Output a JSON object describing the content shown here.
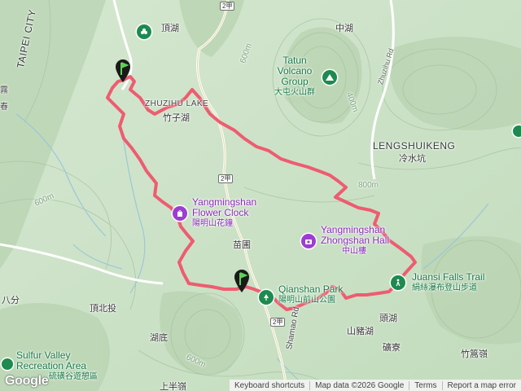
{
  "map": {
    "route_color": "#ee5c70",
    "labels": {
      "dinghu": "頂湖",
      "zhonghu": "中湖",
      "taipei_city": "TAIPEI CITY",
      "tatun_group_en": "Tatun Volcano Group",
      "tatun_group_zh": "大屯火山群",
      "zhuzihu_en": "ZHUZIHU LAKE",
      "zhuzihu_zh": "竹子湖",
      "zhuzihu_rd": "Zhuzihu Rd",
      "lengshuikeng_en": "LENGSHUIKENG",
      "lengshuikeng_zh": "冷水坑",
      "flower_clock_en": "Yangmingshan Flower Clock",
      "flower_clock_zh": "陽明山花鐘",
      "miaopu": "苗圃",
      "zhongshan_hall_en": "Yangmingshan Zhongshan Hall",
      "zhongshan_hall_zh": "中山樓",
      "qianshan_park_en": "Qianshan Park",
      "qianshan_park_zh": "陽明山前山公園",
      "juansi_en": "Juansi Falls Trail",
      "juansi_zh": "絹絲瀑布登山步道",
      "dingbeitou": "頂北投",
      "bafen": "八分",
      "hudi": "湖底",
      "toutian": "頭湖",
      "shanzhuhu": "山豬湖",
      "kuangliao": "礦寮",
      "zhuzailing": "竹篙嶺",
      "sulfur_valley_en": "Sulfur Valley Recreation Area",
      "sulfur_valley_zh": "硫磺谷遊憩區",
      "shangbanling": "上半嶺",
      "shamao_rd": "Shamao Rd",
      "left_edge_1": "霧",
      "left_edge_2": "春"
    },
    "contours": [
      "600m",
      "400m",
      "800m",
      "600m",
      "600m"
    ],
    "road_shields": [
      "2甲",
      "2甲",
      "2甲"
    ],
    "attribution": {
      "shortcuts": "Keyboard shortcuts",
      "data": "Map data ©2026 Google",
      "terms": "Terms",
      "report": "Report a map error"
    },
    "logo": "Google"
  }
}
